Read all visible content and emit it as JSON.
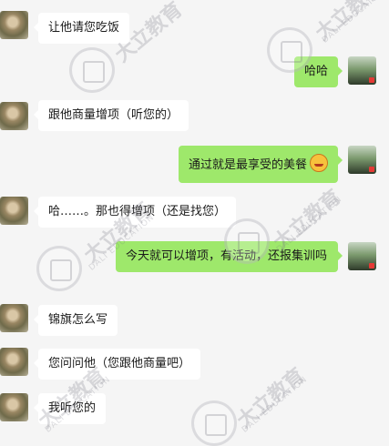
{
  "chat": {
    "messages": [
      {
        "side": "in",
        "text": "让他请您吃饭"
      },
      {
        "side": "out",
        "text": "哈哈"
      },
      {
        "side": "in",
        "text": "跟他商量增项（听您的）"
      },
      {
        "side": "out",
        "text": "通过就是最享受的美餐",
        "emoji": "savoring-food-emoji-icon"
      },
      {
        "side": "in",
        "text": "哈……。那也得增项（还是找您）"
      },
      {
        "side": "out",
        "text": "今天就可以增项，有活动，还报集训吗"
      },
      {
        "side": "in",
        "text": "锦旗怎么写"
      },
      {
        "side": "in",
        "text": "您问问他（您跟他商量吧）"
      },
      {
        "side": "in",
        "text": "我听您的"
      }
    ]
  },
  "watermark": {
    "brand": "大立教育",
    "brand_en": "DALI EDUCATION"
  },
  "colors": {
    "background": "#f5f5f5",
    "incoming_bubble": "#ffffff",
    "outgoing_bubble": "#9ee86b"
  }
}
